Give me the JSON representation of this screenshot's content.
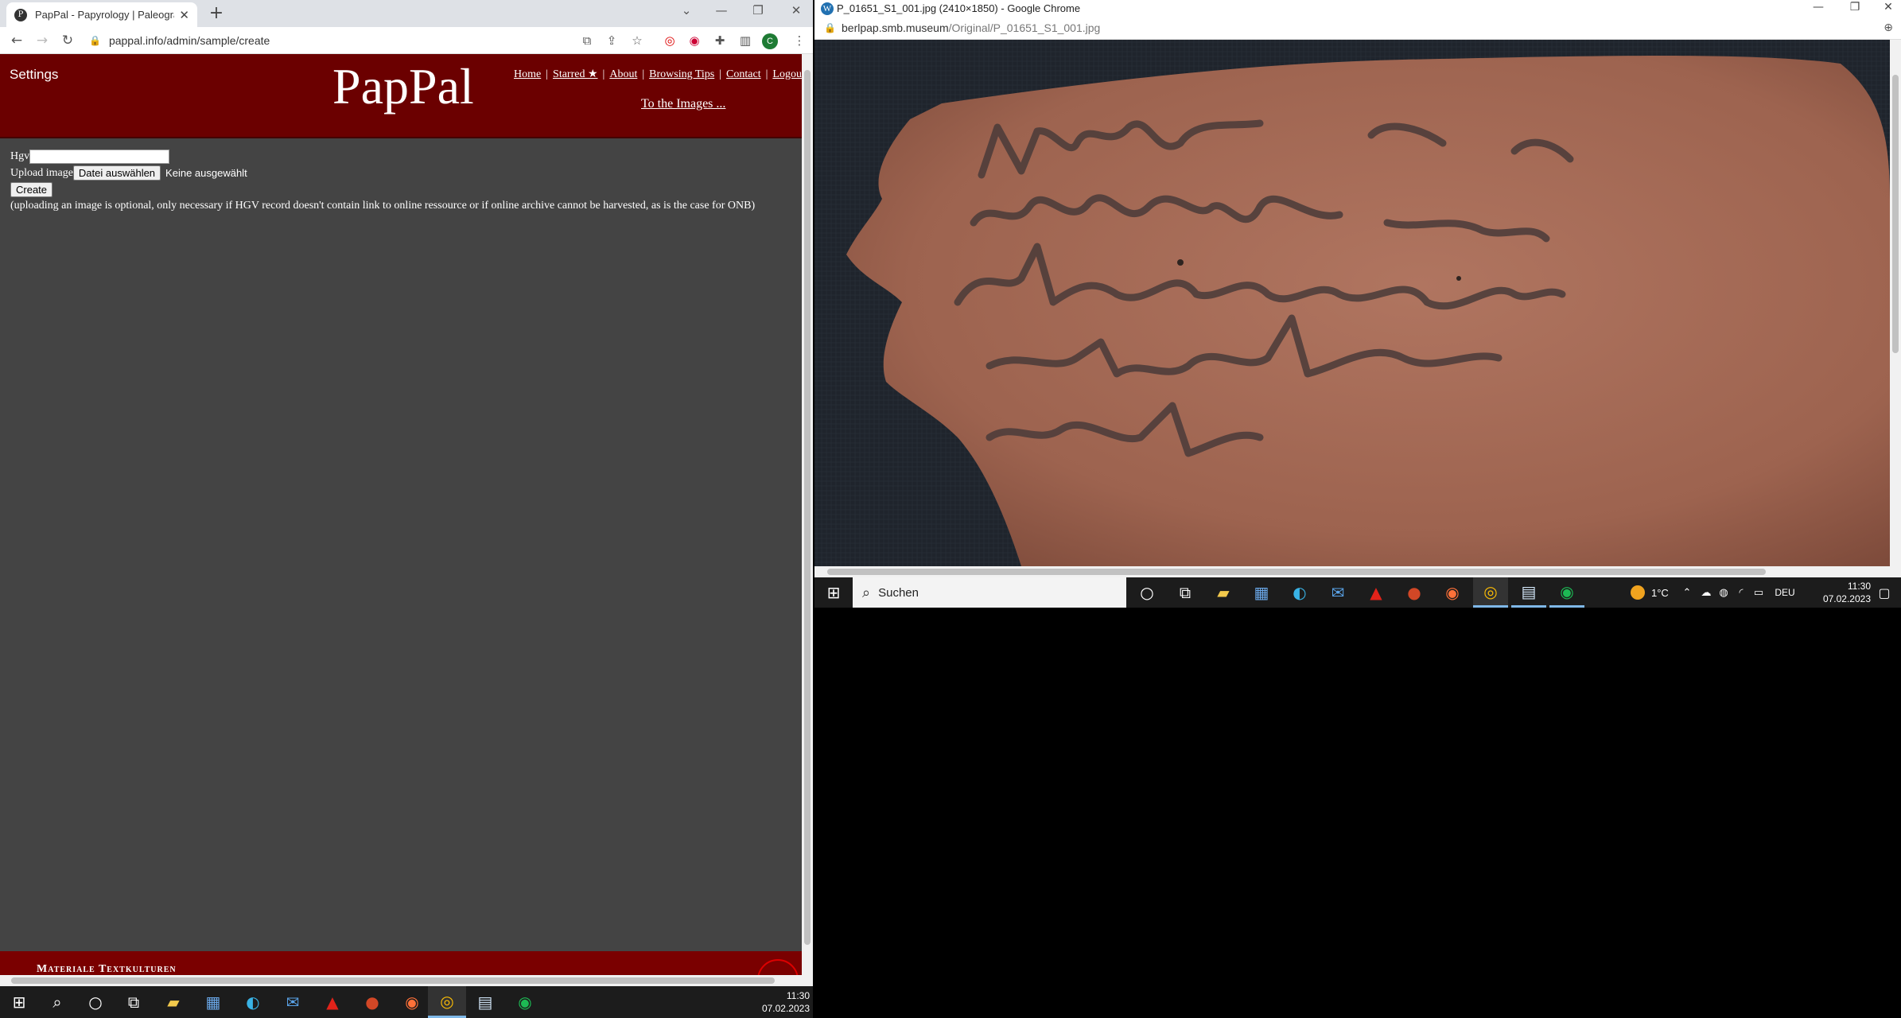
{
  "left_browser": {
    "tab_title": "PapPal - Papyrology | Paleograph",
    "url": "pappal.info/admin/sample/create"
  },
  "site": {
    "settings_label": "Settings",
    "brand": "PapPal",
    "nav": [
      "Home",
      "Starred ★",
      "About",
      "Browsing Tips",
      "Contact",
      "Logou"
    ],
    "to_images": "To the Images ...",
    "form": {
      "hgv_label": "Hgv",
      "hgv_value": "",
      "upload_label": "Upload image",
      "choose_file_button": "Datei auswählen",
      "file_status": "Keine ausgewählt",
      "create_button": "Create",
      "note": "(uploading an image is optional, only necessary if HGV record doesn't contain link to online ressource or if online archive cannot be harvested, as is the case for ONB)"
    },
    "footer_text": "Materiale Textkulturen"
  },
  "right_browser": {
    "title": "P_01651_S1_001.jpg (2410×1850) - Google Chrome",
    "url_host": "berlpap.smb.museum",
    "url_path": "/Original/P_01651_S1_001.jpg"
  },
  "taskbar_left": {
    "time": "11:30",
    "date": "07.02.2023"
  },
  "taskbar_right": {
    "search_label": "Suchen",
    "temperature": "1°C",
    "language": "DEU",
    "time": "11:30",
    "date": "07.02.2023"
  }
}
